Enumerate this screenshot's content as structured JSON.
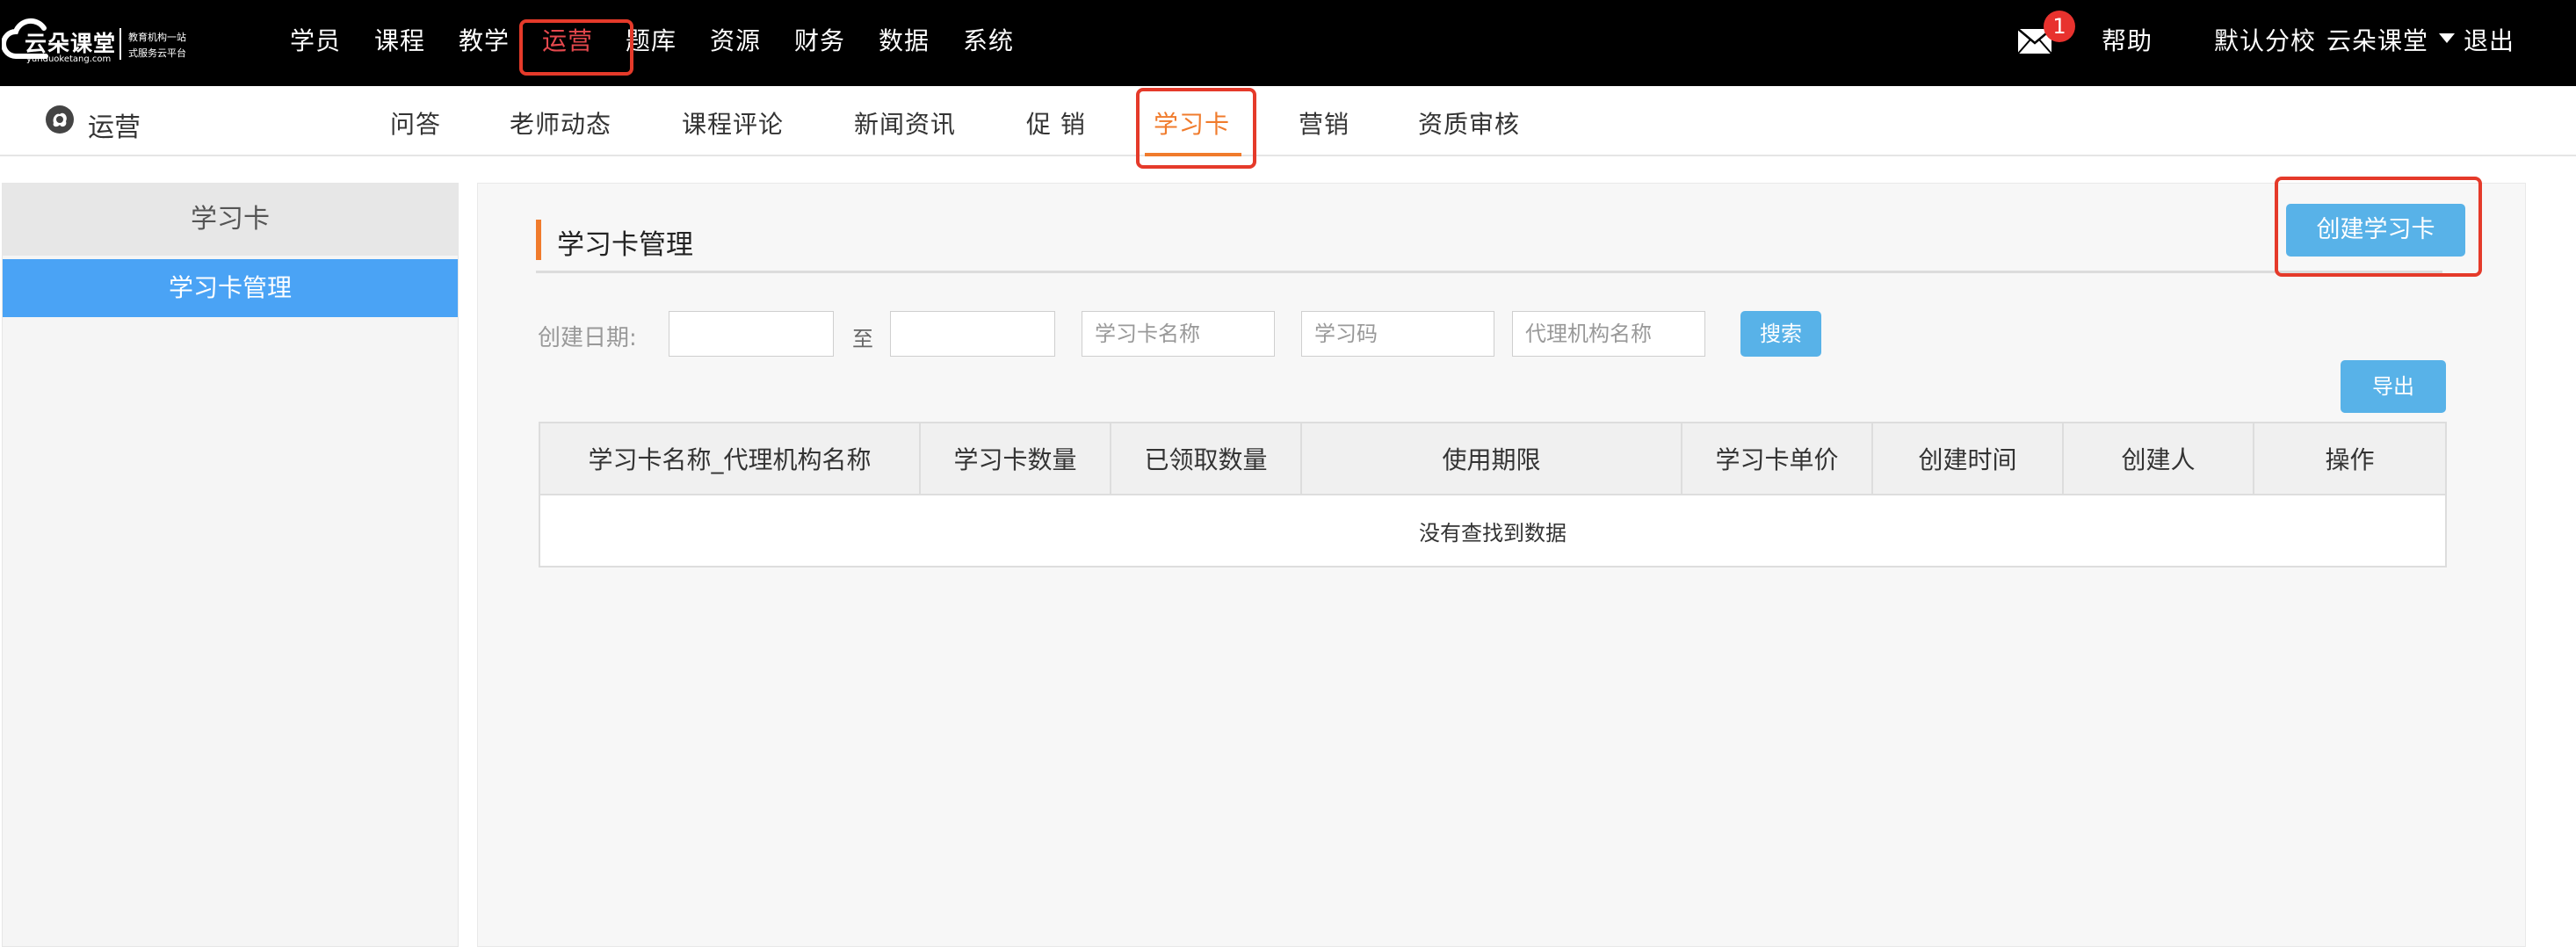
{
  "logo": {
    "name": "云朵课堂",
    "domain": "yunduoketang.com",
    "tagline_1": "教育机构一站",
    "tagline_2": "式服务云平台"
  },
  "main_nav": [
    "学员",
    "课程",
    "教学",
    "运营",
    "题库",
    "资源",
    "财务",
    "数据",
    "系统"
  ],
  "main_nav_active": "运营",
  "notifications": {
    "count": "1"
  },
  "top_right": {
    "help": "帮助",
    "branch": "默认分校",
    "user": "云朵课堂",
    "logout": "退出"
  },
  "sub_nav": {
    "title": "运营",
    "items": [
      "问答",
      "老师动态",
      "课程评论",
      "新闻资讯",
      "促 销",
      "学习卡",
      "营销",
      "资质审核"
    ],
    "active": "学习卡"
  },
  "sidebar": {
    "header": "学习卡",
    "items": [
      "学习卡管理"
    ]
  },
  "main": {
    "section_title": "学习卡管理",
    "create_button": "创建学习卡",
    "filters": {
      "date_label": "创建日期:",
      "to_label": "至",
      "card_name_placeholder": "学习卡名称",
      "code_placeholder": "学习码",
      "agency_placeholder": "代理机构名称",
      "search_button": "搜索"
    },
    "export_button": "导出",
    "table": {
      "columns": [
        "学习卡名称_代理机构名称",
        "学习卡数量",
        "已领取数量",
        "使用期限",
        "学习卡单价",
        "创建时间",
        "创建人",
        "操作"
      ],
      "empty_text": "没有查找到数据"
    }
  },
  "colors": {
    "accent_blue": "#4aa3f5",
    "button_blue": "#58b2e8",
    "accent_orange": "#f07b2c",
    "highlight_red": "#e53a2a"
  }
}
